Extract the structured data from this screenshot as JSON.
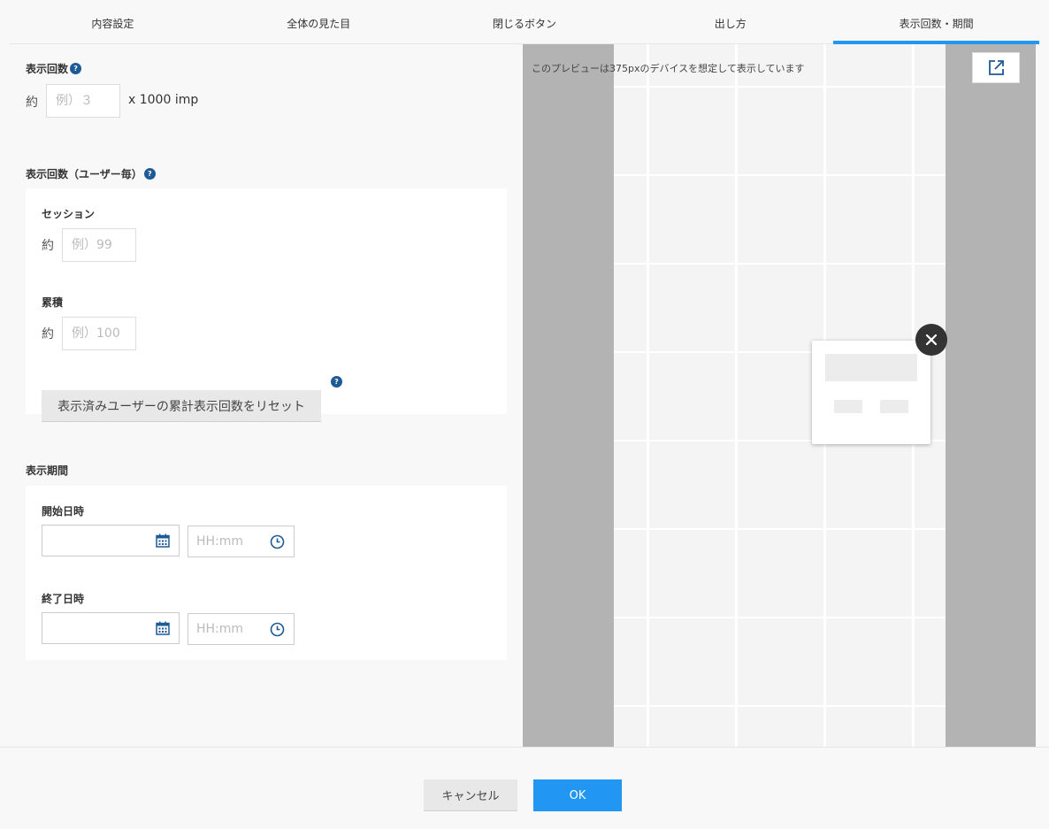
{
  "tabs": [
    {
      "label": "内容設定",
      "active": false
    },
    {
      "label": "全体の見た目",
      "active": false
    },
    {
      "label": "閉じるボタン",
      "active": false
    },
    {
      "label": "出し方",
      "active": false
    },
    {
      "label": "表示回数・期間",
      "active": true
    }
  ],
  "accent_color": "#2196f3",
  "help_icon": "?",
  "impressions": {
    "title": "表示回数",
    "approx": "約",
    "placeholder": "例）３",
    "unit": "x 1000 imp"
  },
  "per_user": {
    "title": "表示回数（ユーザー毎）",
    "session": {
      "label": "セッション",
      "approx": "約",
      "placeholder": "例）99"
    },
    "cumulative": {
      "label": "累積",
      "approx": "約",
      "placeholder": "例）100"
    },
    "reset_button": "表示済みユーザーの累計表示回数をリセット"
  },
  "period": {
    "title": "表示期間",
    "start": {
      "label": "開始日時",
      "date_value": "",
      "time_placeholder": "HH:mm"
    },
    "end": {
      "label": "終了日時",
      "date_value": "",
      "time_placeholder": "HH:mm"
    }
  },
  "preview": {
    "note": "このプレビューは375pxのデバイスを想定して表示しています",
    "external_icon": "external-link-icon",
    "close_icon": "close-icon"
  },
  "footer": {
    "cancel_label": "キャンセル",
    "ok_label": "OK"
  }
}
